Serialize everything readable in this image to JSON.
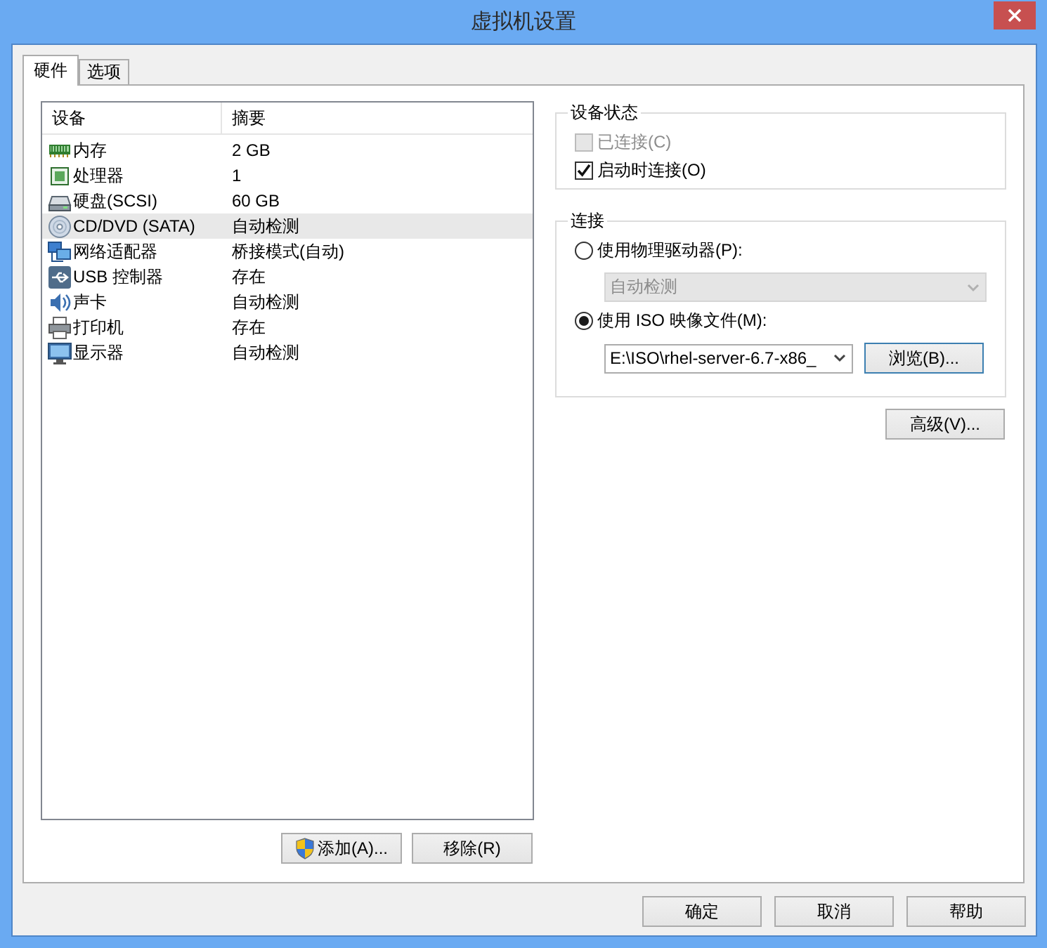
{
  "window": {
    "title": "虚拟机设置"
  },
  "tabs": [
    {
      "label": "硬件",
      "selected": true
    },
    {
      "label": "选项",
      "selected": false
    }
  ],
  "device_list": {
    "columns": [
      "设备",
      "摘要"
    ],
    "rows": [
      {
        "kind": "memory",
        "device": "内存",
        "summary": "2 GB",
        "selected": false
      },
      {
        "kind": "processor",
        "device": "处理器",
        "summary": "1",
        "selected": false
      },
      {
        "kind": "disk",
        "device": "硬盘(SCSI)",
        "summary": "60 GB",
        "selected": false
      },
      {
        "kind": "cd",
        "device": "CD/DVD (SATA)",
        "summary": "自动检测",
        "selected": true
      },
      {
        "kind": "network",
        "device": "网络适配器",
        "summary": "桥接模式(自动)",
        "selected": false
      },
      {
        "kind": "usb",
        "device": "USB 控制器",
        "summary": "存在",
        "selected": false
      },
      {
        "kind": "sound",
        "device": "声卡",
        "summary": "自动检测",
        "selected": false
      },
      {
        "kind": "printer",
        "device": "打印机",
        "summary": "存在",
        "selected": false
      },
      {
        "kind": "display",
        "device": "显示器",
        "summary": "自动检测",
        "selected": false
      }
    ]
  },
  "list_buttons": [
    {
      "kind": "admin",
      "label": "添加(A)..."
    },
    {
      "kind": "plain",
      "label": "移除(R)"
    }
  ],
  "device_status": {
    "title": "设备状态",
    "options": [
      {
        "label": "已连接(C)",
        "checked": false,
        "disabled": true
      },
      {
        "label": "启动时连接(O)",
        "checked": true,
        "disabled": false
      }
    ]
  },
  "connection": {
    "title": "连接",
    "options": [
      {
        "label": "使用物理驱动器(P):",
        "selected": false,
        "dropdown": {
          "value": "自动检测",
          "disabled": true
        }
      },
      {
        "label": "使用 ISO 映像文件(M):",
        "selected": true,
        "dropdown": {
          "value": "E:\\ISO\\rhel-server-6.7-x86_",
          "disabled": false
        },
        "button": "浏览(B)..."
      }
    ]
  },
  "advanced_button": "高级(V)...",
  "dialog_buttons": [
    "确定",
    "取消",
    "帮助"
  ]
}
